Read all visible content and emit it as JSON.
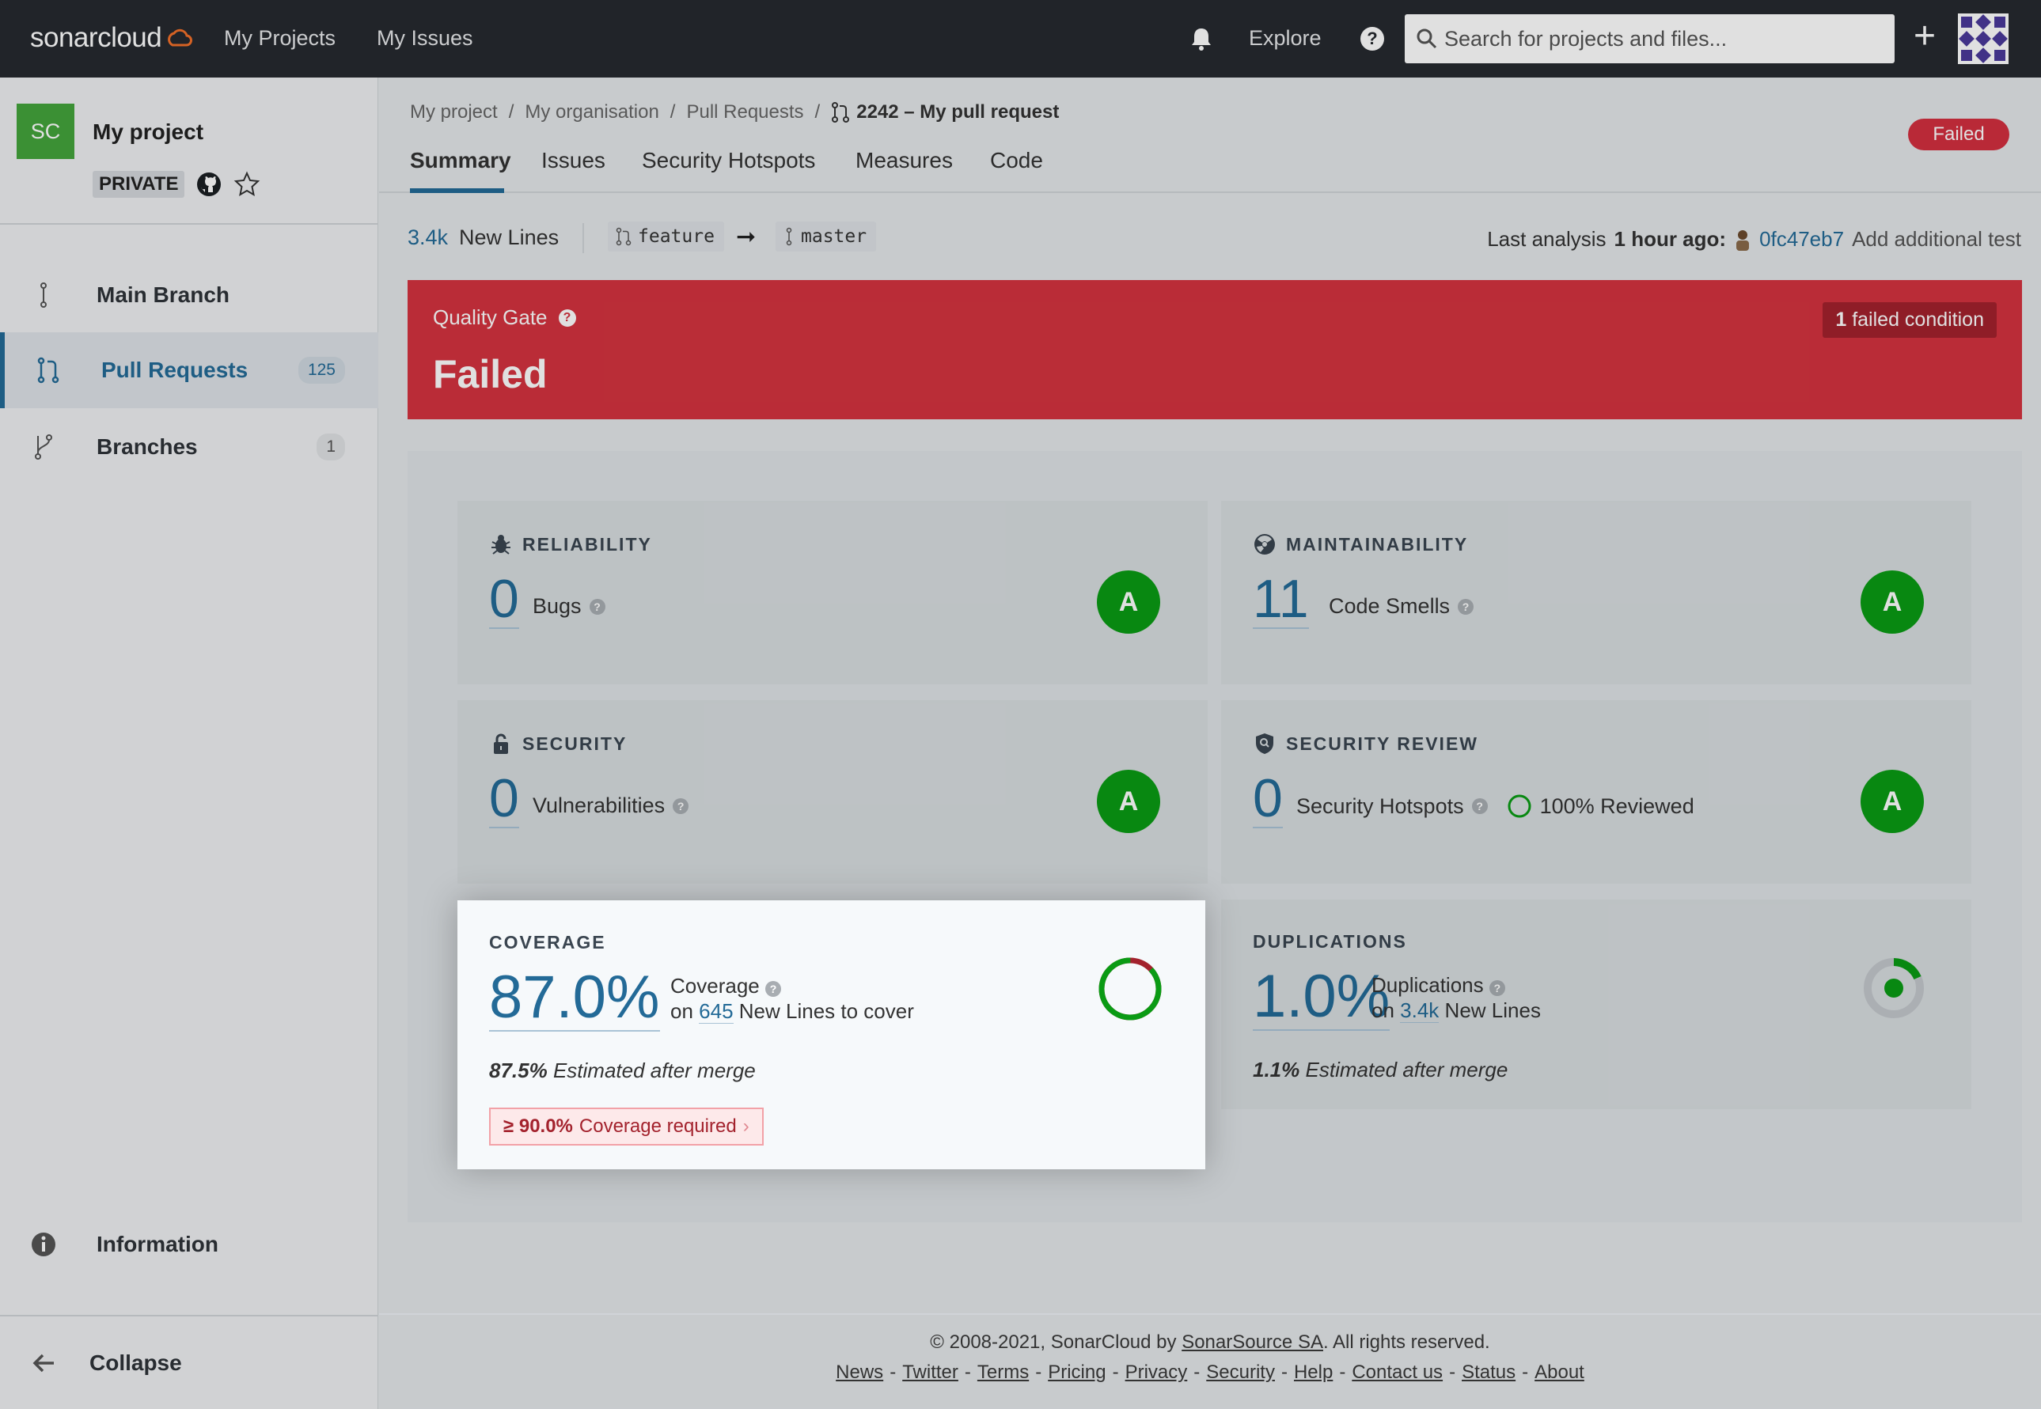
{
  "topbar": {
    "brand_light": "sonar",
    "brand_bold": "cloud",
    "nav": [
      "My Projects",
      "My Issues"
    ],
    "explore": "Explore",
    "help": "?",
    "search_placeholder": "Search for projects and files...",
    "plus": "+"
  },
  "sidebar": {
    "project_initials": "SC",
    "project_name": "My project",
    "visibility": "PRIVATE",
    "items": [
      {
        "label": "Main Branch",
        "icon": "main-branch-icon"
      },
      {
        "label": "Pull Requests",
        "icon": "pull-request-icon",
        "count": "125"
      },
      {
        "label": "Branches",
        "icon": "branch-icon",
        "count": "1"
      }
    ],
    "information": "Information",
    "collapse": "Collapse"
  },
  "breadcrumb": {
    "items": [
      "My project",
      "My organisation",
      "Pull Requests"
    ],
    "separator": "/",
    "current": "2242 – My pull request"
  },
  "status_pill": "Failed",
  "tabs": [
    "Summary",
    "Issues",
    "Security Hotspots",
    "Measures",
    "Code"
  ],
  "summary_bar": {
    "new_lines_value": "3.4k",
    "new_lines_label": "New Lines",
    "source_branch": "feature",
    "target_branch": "master",
    "analysis_prefix": "Last analysis",
    "analysis_time": "1 hour ago:",
    "commit": "0fc47eb7",
    "extra": "Add additional test"
  },
  "quality_gate": {
    "title": "Quality Gate",
    "help": "?",
    "status": "Failed",
    "failed_count": "1",
    "failed_label": "failed condition"
  },
  "metrics": {
    "reliability": {
      "title": "RELIABILITY",
      "value": "0",
      "label": "Bugs",
      "rating": "A"
    },
    "maintainability": {
      "title": "MAINTAINABILITY",
      "value": "11",
      "label": "Code Smells",
      "rating": "A"
    },
    "security": {
      "title": "SECURITY",
      "value": "0",
      "label": "Vulnerabilities",
      "rating": "A"
    },
    "security_review": {
      "title": "SECURITY REVIEW",
      "value": "0",
      "label": "Security Hotspots",
      "reviewed": "100% Reviewed",
      "rating": "A"
    },
    "coverage": {
      "title": "COVERAGE",
      "value": "87.0%",
      "label": "Coverage",
      "on": "on",
      "lines": "645",
      "lines_label": "New Lines to cover",
      "estimated_value": "87.5%",
      "estimated_label": "Estimated after merge",
      "required_value": "≥ 90.0%",
      "required_label": "Coverage required",
      "percent": 87.0
    },
    "duplications": {
      "title": "DUPLICATIONS",
      "value": "1.0%",
      "label": "Duplications",
      "on": "on",
      "lines": "3.4k",
      "lines_label": "New Lines",
      "estimated_value": "1.1%",
      "estimated_label": "Estimated after merge"
    }
  },
  "footer": {
    "copyright_prefix": "© 2008-2021, SonarCloud by",
    "company": "SonarSource SA",
    "copyright_suffix": ". All rights reserved.",
    "links": [
      "News",
      "Twitter",
      "Terms",
      "Pricing",
      "Privacy",
      "Security",
      "Help",
      "Contact us",
      "Status",
      "About"
    ]
  },
  "colors": {
    "failed": "#d4333f",
    "rating_a": "#0a9b14",
    "link": "#236a97",
    "topbar": "#262a2f"
  }
}
